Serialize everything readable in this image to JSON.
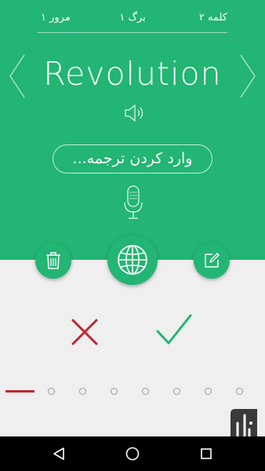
{
  "header": {
    "word_counter": "کلمه ۲",
    "page_counter": "برگ ۱",
    "review_counter": "مرور ۱"
  },
  "card": {
    "word": "Revolution",
    "translation_placeholder": "وارد کردن ترجمه..."
  },
  "actions": {
    "delete_icon": "trash-icon",
    "translate_icon": "globe-icon",
    "edit_icon": "edit-icon"
  },
  "answer": {
    "wrong_icon": "cross-icon",
    "correct_icon": "check-icon"
  },
  "progress": {
    "total": 8,
    "current_index": 1
  },
  "colors": {
    "primary": "#22b573",
    "wrong": "#c0272d",
    "correct": "#22b573",
    "background": "#efefef",
    "navbar": "#000000"
  },
  "navbar": {
    "back_icon": "back-triangle-icon",
    "home_icon": "home-circle-icon",
    "recent_icon": "recent-square-icon"
  }
}
